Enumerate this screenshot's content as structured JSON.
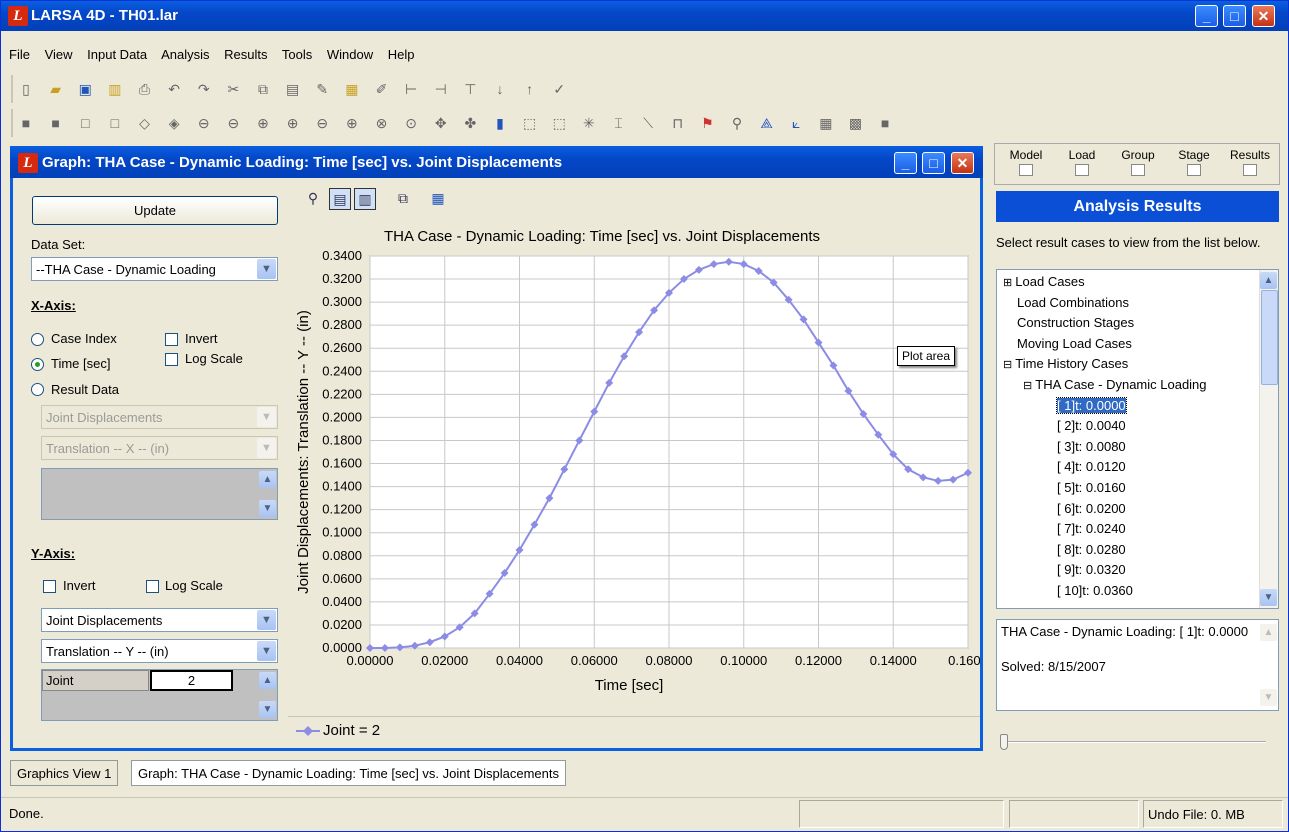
{
  "app": {
    "title": "LARSA 4D - TH01.lar",
    "logo_letter": "L"
  },
  "menu": [
    "File",
    "View",
    "Input Data",
    "Analysis",
    "Results",
    "Tools",
    "Window",
    "Help"
  ],
  "graph_window": {
    "title": "Graph: THA Case - Dynamic Loading: Time [sec] vs. Joint Displacements"
  },
  "left": {
    "update_label": "Update",
    "dataset_label": "Data Set:",
    "dataset_value": "--THA Case - Dynamic Loading",
    "xaxis_label": "X-Axis:",
    "x_case_index": "Case Index",
    "x_time": "Time [sec]",
    "x_result_data": "Result Data",
    "x_invert": "Invert",
    "x_log": "Log Scale",
    "x_combo1": "Joint Displacements",
    "x_combo2": "Translation -- X -- (in)",
    "yaxis_label": "Y-Axis:",
    "y_invert": "Invert",
    "y_log": "Log Scale",
    "y_combo1": "Joint Displacements",
    "y_combo2": "Translation -- Y -- (in)",
    "joint_label": "Joint",
    "joint_value": "2"
  },
  "tooltip": "Plot area",
  "chart_data": {
    "type": "line",
    "title": "THA Case - Dynamic Loading: Time [sec] vs. Joint Displacements",
    "xlabel": "Time [sec]",
    "ylabel": "Joint Displacements: Translation -- Y -- (in)",
    "xlim": [
      0.0,
      0.16
    ],
    "ylim": [
      0.0,
      0.34
    ],
    "xticks": [
      "0.00000",
      "0.02000",
      "0.04000",
      "0.06000",
      "0.08000",
      "0.10000",
      "0.12000",
      "0.14000",
      "0.1600"
    ],
    "yticks": [
      "0.0000",
      "0.0200",
      "0.0400",
      "0.0600",
      "0.0800",
      "0.1000",
      "0.1200",
      "0.1400",
      "0.1600",
      "0.1800",
      "0.2000",
      "0.2200",
      "0.2400",
      "0.2600",
      "0.2800",
      "0.3000",
      "0.3200",
      "0.3400"
    ],
    "grid": true,
    "series": [
      {
        "name": "Joint = 2",
        "color": "#8c8ce6",
        "x": [
          0.0,
          0.004,
          0.008,
          0.012,
          0.016,
          0.02,
          0.024,
          0.028,
          0.032,
          0.036,
          0.04,
          0.044,
          0.048,
          0.052,
          0.056,
          0.06,
          0.064,
          0.068,
          0.072,
          0.076,
          0.08,
          0.084,
          0.088,
          0.092,
          0.096,
          0.1,
          0.104,
          0.108,
          0.112,
          0.116,
          0.12,
          0.124,
          0.128,
          0.132,
          0.136,
          0.14,
          0.144,
          0.148,
          0.152,
          0.156,
          0.16
        ],
        "y": [
          0.0,
          0.0,
          0.0005,
          0.002,
          0.005,
          0.01,
          0.018,
          0.03,
          0.047,
          0.065,
          0.085,
          0.107,
          0.13,
          0.155,
          0.18,
          0.205,
          0.23,
          0.253,
          0.274,
          0.293,
          0.308,
          0.32,
          0.328,
          0.333,
          0.335,
          0.333,
          0.327,
          0.317,
          0.302,
          0.285,
          0.265,
          0.245,
          0.223,
          0.203,
          0.185,
          0.168,
          0.155,
          0.148,
          0.145,
          0.146,
          0.152
        ]
      }
    ]
  },
  "right": {
    "tabs": [
      "Model",
      "Load",
      "Group",
      "Stage",
      "Results"
    ],
    "header": "Analysis Results",
    "instruction": "Select result cases to view from the list below.",
    "tree": [
      {
        "label": "Load Cases",
        "level": 0,
        "expander": "⊞"
      },
      {
        "label": "Load Combinations",
        "level": 0,
        "expander": ""
      },
      {
        "label": "Construction Stages",
        "level": 0,
        "expander": ""
      },
      {
        "label": "Moving Load Cases",
        "level": 0,
        "expander": ""
      },
      {
        "label": "Time History Cases",
        "level": 0,
        "expander": "⊟"
      },
      {
        "label": "THA Case - Dynamic Loading",
        "level": 1,
        "expander": "⊟"
      },
      {
        "label": "[ 1]t: 0.0000",
        "level": 2,
        "selected": true
      },
      {
        "label": "[ 2]t: 0.0040",
        "level": 2
      },
      {
        "label": "[ 3]t: 0.0080",
        "level": 2
      },
      {
        "label": "[ 4]t: 0.0120",
        "level": 2
      },
      {
        "label": "[ 5]t: 0.0160",
        "level": 2
      },
      {
        "label": "[ 6]t: 0.0200",
        "level": 2
      },
      {
        "label": "[ 7]t: 0.0240",
        "level": 2
      },
      {
        "label": "[ 8]t: 0.0280",
        "level": 2
      },
      {
        "label": "[ 9]t: 0.0320",
        "level": 2
      },
      {
        "label": "[ 10]t: 0.0360",
        "level": 2
      }
    ],
    "info_line1": "THA Case - Dynamic Loading: [ 1]t: 0.0000",
    "info_line2": "Solved: 8/15/2007"
  },
  "bottom_tabs": [
    "Graphics View 1",
    "Graph: THA Case - Dynamic Loading: Time [sec] vs. Joint Displacements"
  ],
  "status": {
    "left": "Done.",
    "right": "Undo File: 0. MB"
  }
}
